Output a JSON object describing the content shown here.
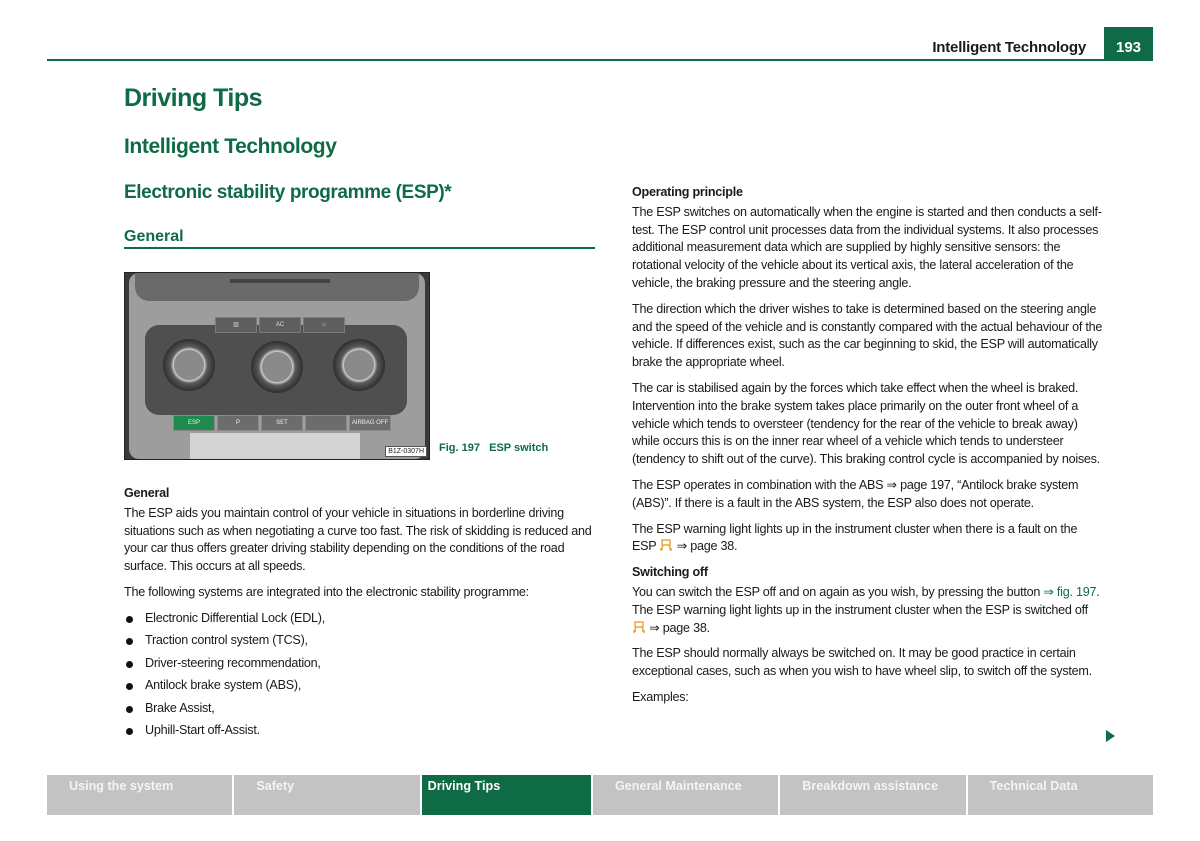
{
  "header": {
    "section_title": "Intelligent Technology",
    "page_number": "193"
  },
  "headings": {
    "chapter": "Driving Tips",
    "section": "Intelligent Technology",
    "topic": "Electronic stability programme (ESP)*",
    "subtopic": "General"
  },
  "figure": {
    "image_code": "B1Z-0307H",
    "caption": "Fig. 197   ESP switch",
    "panel_labels": {
      "top_buttons": [
        "▥",
        "AC",
        "⌂"
      ],
      "bottom_buttons": [
        "ESP",
        "P",
        "SET",
        "",
        "AIRBAG OFF"
      ]
    }
  },
  "left_column": {
    "general_heading": "General",
    "general_para": "The ESP aids you maintain control of your vehicle in situations in borderline driving situations such as when negotiating a curve too fast. The risk of skidding is reduced and your car thus offers greater driving stability depending on the conditions of the road surface. This occurs at all speeds.",
    "systems_intro": "The following systems are integrated into the electronic stability programme:",
    "systems": [
      "Electronic Differential Lock (EDL),",
      "Traction control system (TCS),",
      "Driver-steering recommendation,",
      "Antilock brake system (ABS),",
      "Brake Assist,",
      "Uphill-Start off-Assist."
    ]
  },
  "right_column": {
    "operating_heading": "Operating principle",
    "operating_para1": "The ESP switches on automatically when the engine is started and then conducts a self-test. The ESP control unit processes data from the individual systems. It also processes additional measurement data which are supplied by highly sensitive sensors: the rotational velocity of the vehicle about its vertical axis, the lateral acceleration of the vehicle, the braking pressure and the steering angle.",
    "operating_para2": "The direction which the driver wishes to take is determined based on the steering angle and the speed of the vehicle and is constantly compared with the actual behaviour of the vehicle. If differences exist, such as the car beginning to skid, the ESP will automatically brake the appropriate wheel.",
    "operating_para3": "The car is stabilised again by the forces which take effect when the wheel is braked. Intervention into the brake system takes place primarily on the outer front wheel of a vehicle which tends to oversteer (tendency for the rear of the vehicle to break away) while occurs this is on the inner rear wheel of a vehicle which tends to understeer (tendency to shift out of the curve). This braking control cycle is accompanied by noises.",
    "abs_para_pre": "The ESP operates in combination with the ABS ",
    "abs_para_ref": "⇒ page 197, “Antilock brake system (ABS)”",
    "abs_para_post": ". If there is a fault in the ABS system, the ESP also does not operate.",
    "warning_para_pre": "The ESP warning light lights up in the instrument cluster when there is a fault on the ESP ",
    "warning_para_ref": " ⇒ page 38.",
    "switching_heading": "Switching off",
    "switch_para_pre": "You can switch the ESP off and on again as you wish, by pressing the button ",
    "switch_para_link": "⇒ fig. 197",
    "switch_para_mid": ". The ESP warning light lights up in the instrument cluster when the ESP is switched off ",
    "switch_para_ref": " ⇒ page 38.",
    "normal_para": "The ESP should normally always be switched on. It may be good practice in certain exceptional cases, such as when you wish to have wheel slip, to switch off the system.",
    "examples": "Examples:"
  },
  "footer_tabs": [
    {
      "label": "Using the system",
      "active": false
    },
    {
      "label": "Safety",
      "active": false
    },
    {
      "label": "Driving Tips",
      "active": true
    },
    {
      "label": "General Maintenance",
      "active": false
    },
    {
      "label": "Breakdown assistance",
      "active": false
    },
    {
      "label": "Technical Data",
      "active": false
    }
  ],
  "colors": {
    "brand_green": "#0e6b45",
    "tab_gray": "#c3c3c3",
    "warning_amber": "#e8a33a"
  }
}
